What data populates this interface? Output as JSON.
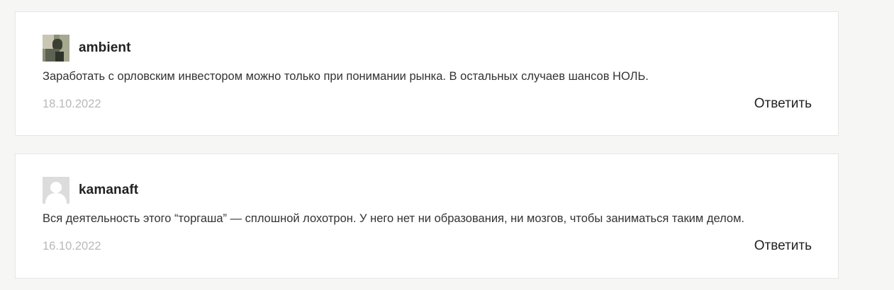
{
  "comments": [
    {
      "author": "ambient",
      "avatar_icon": "user-photo-avatar",
      "text": "Заработать с орловским инвестором можно только при понимании рынка. В остальных случаев шансов НОЛЬ.",
      "date": "18.10.2022",
      "reply_label": "Ответить"
    },
    {
      "author": "kamanaft",
      "avatar_icon": "default-user-avatar",
      "text": "Вся деятельность этого “торгаша” — сплошной лохотрон. У него нет ни образования, ни мозгов, чтобы заниматься таким делом.",
      "date": "16.10.2022",
      "reply_label": "Ответить"
    }
  ],
  "colors": {
    "page_bg": "#f6f6f4",
    "card_bg": "#ffffff",
    "card_border": "#e6e6e6",
    "date_text": "#b9b9b9",
    "body_text": "#333333"
  }
}
